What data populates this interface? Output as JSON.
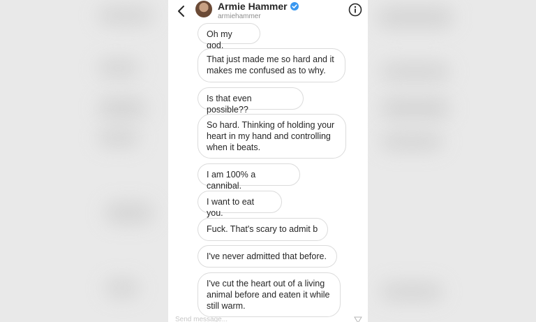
{
  "header": {
    "name": "Armie Hammer",
    "handle": "armiehammer"
  },
  "messages": [
    "Oh my god.",
    "That just made me so hard and it\nmakes me confused as to why.",
    "Is that even possible??",
    "So hard. Thinking of holding your\nheart in my hand and controlling\nwhen it beats.",
    "I am 100% a cannibal.",
    "I want to eat you.",
    "Fuck. That's scary to admit b",
    "I've never admitted that before.",
    "I've cut the heart out of a living\nanimal before and eaten it while\nstill warm."
  ],
  "composer": {
    "placeholder": "Send message..."
  },
  "colors": {
    "verified": "#3897f0",
    "bubble_border": "#dbdbdb",
    "text": "#262626"
  }
}
